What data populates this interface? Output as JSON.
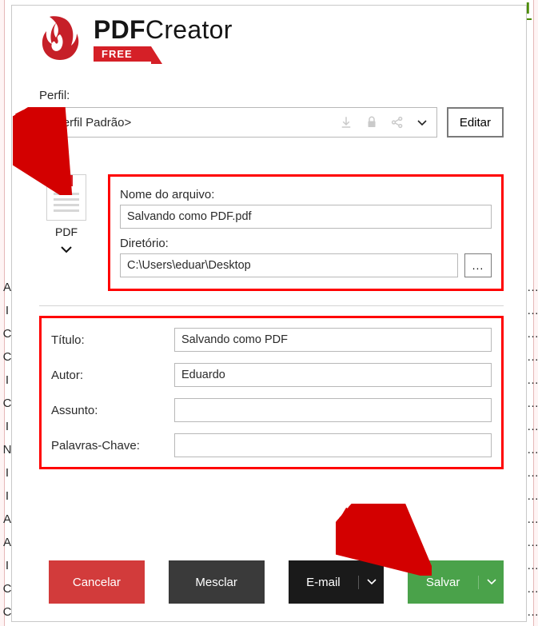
{
  "brand": {
    "name_bold": "PDF",
    "name_rest": "Creator",
    "badge": "FREE"
  },
  "profile": {
    "label": "Perfil:",
    "value": "<Perfil Padrão>",
    "edit_label": "Editar"
  },
  "format": {
    "badge": "PDF",
    "label": "PDF"
  },
  "file": {
    "filename_label": "Nome do arquivo:",
    "filename_value": "Salvando como PDF.pdf",
    "directory_label": "Diretório:",
    "directory_value": "C:\\Users\\eduar\\Desktop",
    "browse_label": "..."
  },
  "meta": {
    "title_label": "Título:",
    "title_value": "Salvando como PDF",
    "author_label": "Autor:",
    "author_value": "Eduardo",
    "subject_label": "Assunto:",
    "subject_value": "",
    "keywords_label": "Palavras-Chave:",
    "keywords_value": ""
  },
  "actions": {
    "cancel": "Cancelar",
    "merge": "Mesclar",
    "email": "E-mail",
    "save": "Salvar"
  },
  "indicator": "I"
}
